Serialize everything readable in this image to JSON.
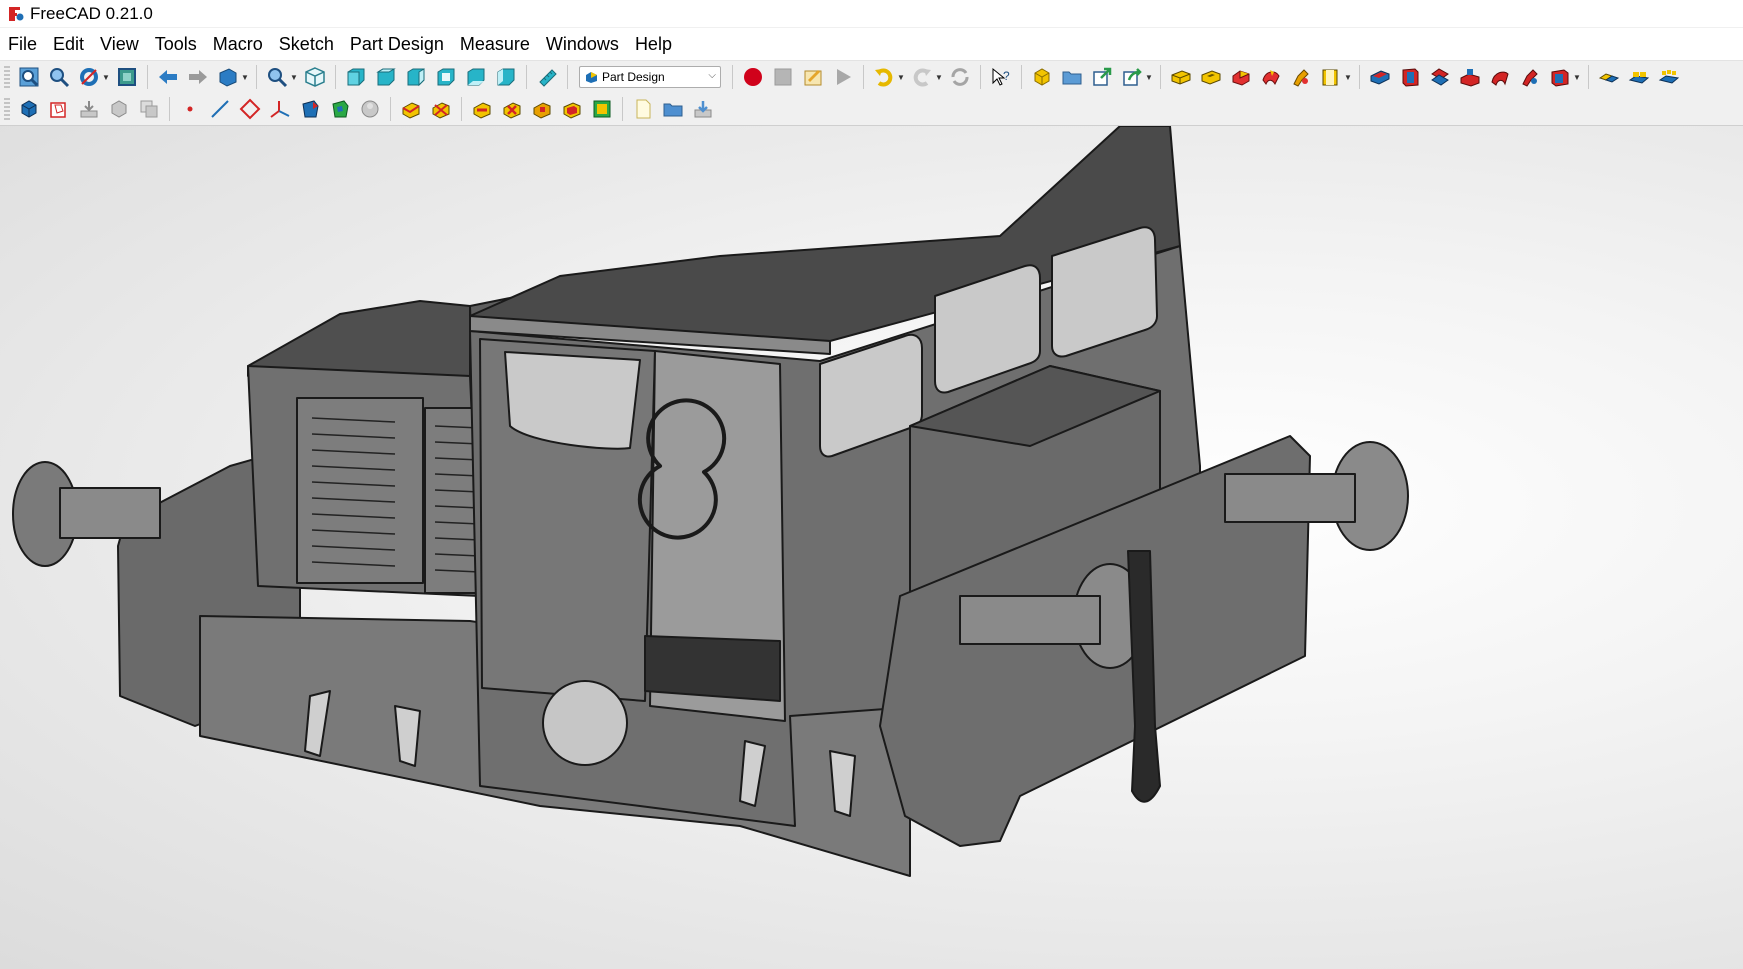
{
  "window": {
    "title": "FreeCAD 0.21.0"
  },
  "menu": [
    "File",
    "Edit",
    "View",
    "Tools",
    "Macro",
    "Sketch",
    "Part Design",
    "Measure",
    "Windows",
    "Help"
  ],
  "workbench_selector": {
    "value": "Part Design"
  },
  "toolbar1_icons": [
    "fit-all-icon",
    "fit-selection-icon",
    "draw-style-icon",
    "bounding-box-icon",
    "back-arrow-icon",
    "forward-arrow-icon",
    "sync-view-icon",
    "zoom-icon",
    "isometric-view-icon",
    "front-view-icon",
    "top-view-icon",
    "right-view-icon",
    "rear-view-icon",
    "bottom-view-icon",
    "left-view-icon",
    "measure-distance-icon",
    "macro-record-icon",
    "macro-stop-icon",
    "macro-edit-icon",
    "macro-run-icon",
    "undo-icon",
    "redo-icon",
    "refresh-icon",
    "whats-this-icon",
    "new-body-icon",
    "open-file-icon",
    "export-icon",
    "share-icon",
    "pad-icon",
    "pocket-icon",
    "revolution-icon",
    "groove-icon",
    "loft-icon",
    "pipe-icon",
    "hole-icon",
    "sub-pad-icon",
    "sub-pocket-icon",
    "sub-revolve-icon",
    "sub-groove-icon",
    "sub-loft-icon",
    "sub-pipe-icon",
    "mirror-icon",
    "linear-pattern-icon",
    "polar-pattern-icon"
  ],
  "toolbar2_icons": [
    "create-body-icon",
    "create-sketch-icon",
    "import-icon",
    "shape-binder-icon",
    "clone-icon",
    "datum-point-icon",
    "datum-line-icon",
    "datum-plane-icon",
    "coordinate-system-icon",
    "sub-shape-binder-icon",
    "shape-binder-green-icon",
    "attach-icon",
    "fillet-icon",
    "chamfer-icon",
    "draft-icon",
    "thickness-icon",
    "boolean-icon",
    "multi-transform-icon",
    "new-document-icon",
    "open-folder-icon",
    "save-icon"
  ],
  "colors": {
    "body": "#6e6e6e",
    "body_dark": "#555555",
    "body_light": "#8a8a8a",
    "glass": "#c9c9c9",
    "accent_record": "#d0021b",
    "part_yellow": "#f2c400",
    "part_red": "#d32525",
    "part_blue": "#1e6fb5",
    "view_cyan": "#27b4c8"
  }
}
